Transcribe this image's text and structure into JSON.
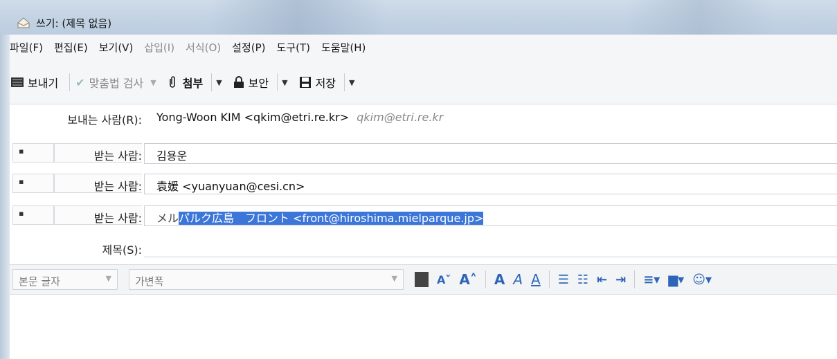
{
  "window": {
    "title": "쓰기: (제목 없음)"
  },
  "menu": {
    "items": [
      "파일(F)",
      "편집(E)",
      "보기(V)",
      "삽입(I)",
      "서식(O)",
      "설정(P)",
      "도구(T)",
      "도움말(H)"
    ]
  },
  "toolbar": {
    "send": "보내기",
    "spell": "맞춤법 검사",
    "attach": "첨부",
    "security": "보안",
    "save": "저장"
  },
  "header": {
    "from_label": "보내는 사람(R):",
    "from_value": "Yong-Woon KIM <qkim@etri.re.kr>",
    "from_hint": "qkim@etri.re.kr",
    "to_label": "받는 사람:",
    "to1": "김용운",
    "to2": "袁媛 <yuanyuan@cesi.cn>",
    "to3_prefix": "メル",
    "to3_selected": "パルク広島　フロント <front@hiroshima.mielparque.jp>",
    "subject_label": "제목(S):"
  },
  "format": {
    "paragraph": "본문 글자",
    "font": "가변폭"
  },
  "colors": {
    "accent": "#2d66b8",
    "selection": "#3b76d8"
  }
}
